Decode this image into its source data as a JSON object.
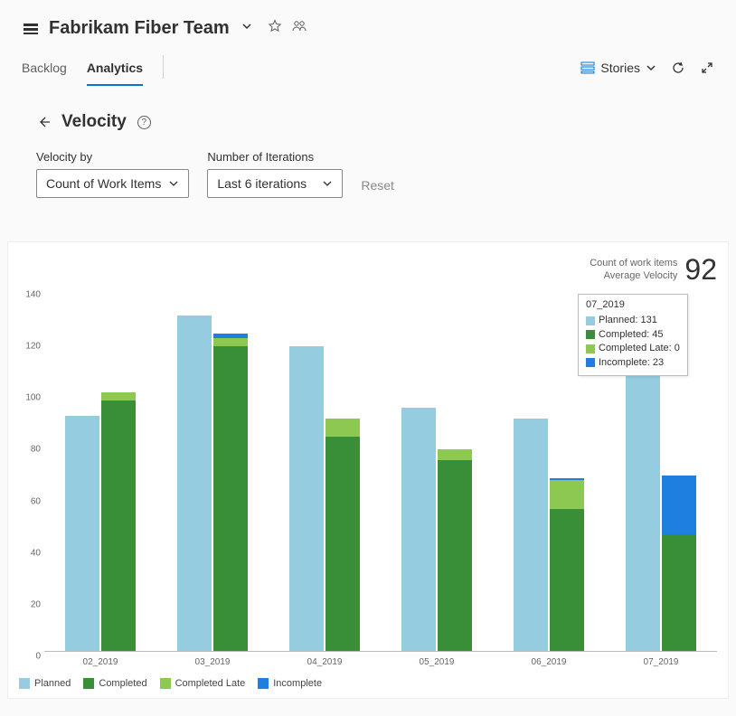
{
  "header": {
    "team_name": "Fabrikam Fiber Team",
    "tabs": [
      "Backlog",
      "Analytics"
    ],
    "active_tab_index": 1,
    "stories_label": "Stories"
  },
  "page": {
    "title": "Velocity",
    "velocity_by_label": "Velocity by",
    "velocity_by_value": "Count of Work Items",
    "iterations_label": "Number of Iterations",
    "iterations_value": "Last 6 iterations",
    "reset_label": "Reset"
  },
  "summary": {
    "line1": "Count of work items",
    "line2": "Average Velocity",
    "value": "92"
  },
  "legend": {
    "planned": "Planned",
    "completed": "Completed",
    "completed_late": "Completed Late",
    "incomplete": "Incomplete"
  },
  "tooltip": {
    "title": "07_2019",
    "rows": [
      {
        "label": "Planned: 131"
      },
      {
        "label": "Completed: 45"
      },
      {
        "label": "Completed Late: 0"
      },
      {
        "label": "Incomplete: 23"
      }
    ]
  },
  "y_ticks": [
    0,
    20,
    40,
    60,
    80,
    100,
    120,
    140
  ],
  "chart_data": {
    "type": "bar",
    "title": "Velocity",
    "xlabel": "",
    "ylabel": "Count of work items",
    "ylim": [
      0,
      140
    ],
    "categories": [
      "02_2019",
      "03_2019",
      "04_2019",
      "05_2019",
      "06_2019",
      "07_2019"
    ],
    "series": [
      {
        "name": "Planned",
        "values": [
          91,
          130,
          118,
          94,
          90,
          131
        ]
      },
      {
        "name": "Completed",
        "values": [
          97,
          118,
          83,
          74,
          55,
          45
        ]
      },
      {
        "name": "Completed Late",
        "values": [
          3,
          3,
          7,
          4,
          11,
          0
        ]
      },
      {
        "name": "Incomplete",
        "values": [
          0,
          2,
          0,
          0,
          1,
          23
        ]
      }
    ],
    "legend_position": "bottom",
    "annotations": [
      "Average Velocity 92"
    ]
  }
}
